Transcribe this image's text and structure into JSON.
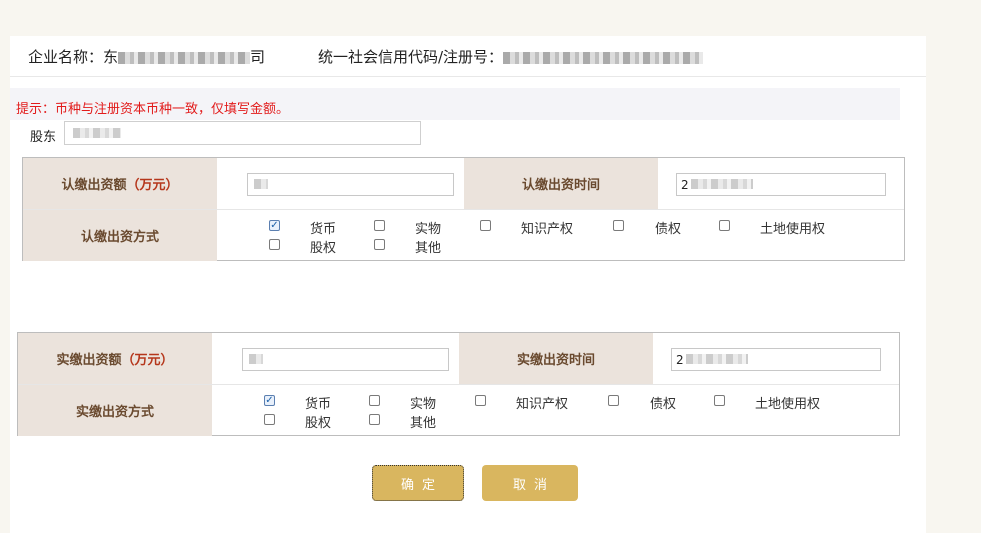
{
  "header": {
    "company_label": "企业名称：",
    "company_prefix": "东",
    "company_suffix": "司",
    "credit_label": "统一社会信用代码/注册号："
  },
  "hint": "提示：币种与注册资本币种一致，仅填写金额。",
  "shareholder": {
    "label": "股东"
  },
  "subscribed": {
    "amount_label": "认缴出资额",
    "amount_unit": "（万元）",
    "time_label": "认缴出资时间",
    "time_prefix": "2",
    "method_label": "认缴出资方式"
  },
  "paid": {
    "amount_label": "实缴出资额",
    "amount_unit": "（万元）",
    "time_label": "实缴出资时间",
    "time_prefix": "2",
    "method_label": "实缴出资方式"
  },
  "methods": [
    {
      "label": "货币",
      "checked": true
    },
    {
      "label": "实物",
      "checked": false
    },
    {
      "label": "知识产权",
      "checked": false
    },
    {
      "label": "债权",
      "checked": false
    },
    {
      "label": "土地使用权",
      "checked": false
    },
    {
      "label": "股权",
      "checked": false
    },
    {
      "label": "其他",
      "checked": false
    }
  ],
  "buttons": {
    "confirm": "确定",
    "cancel": "取消"
  },
  "colors": {
    "label_bg": "#ebe3dc",
    "label_text": "#6a4a2f",
    "unit_text": "#b5361b",
    "hint_text": "#e21b1b",
    "button_bg": "#d9b65f"
  }
}
